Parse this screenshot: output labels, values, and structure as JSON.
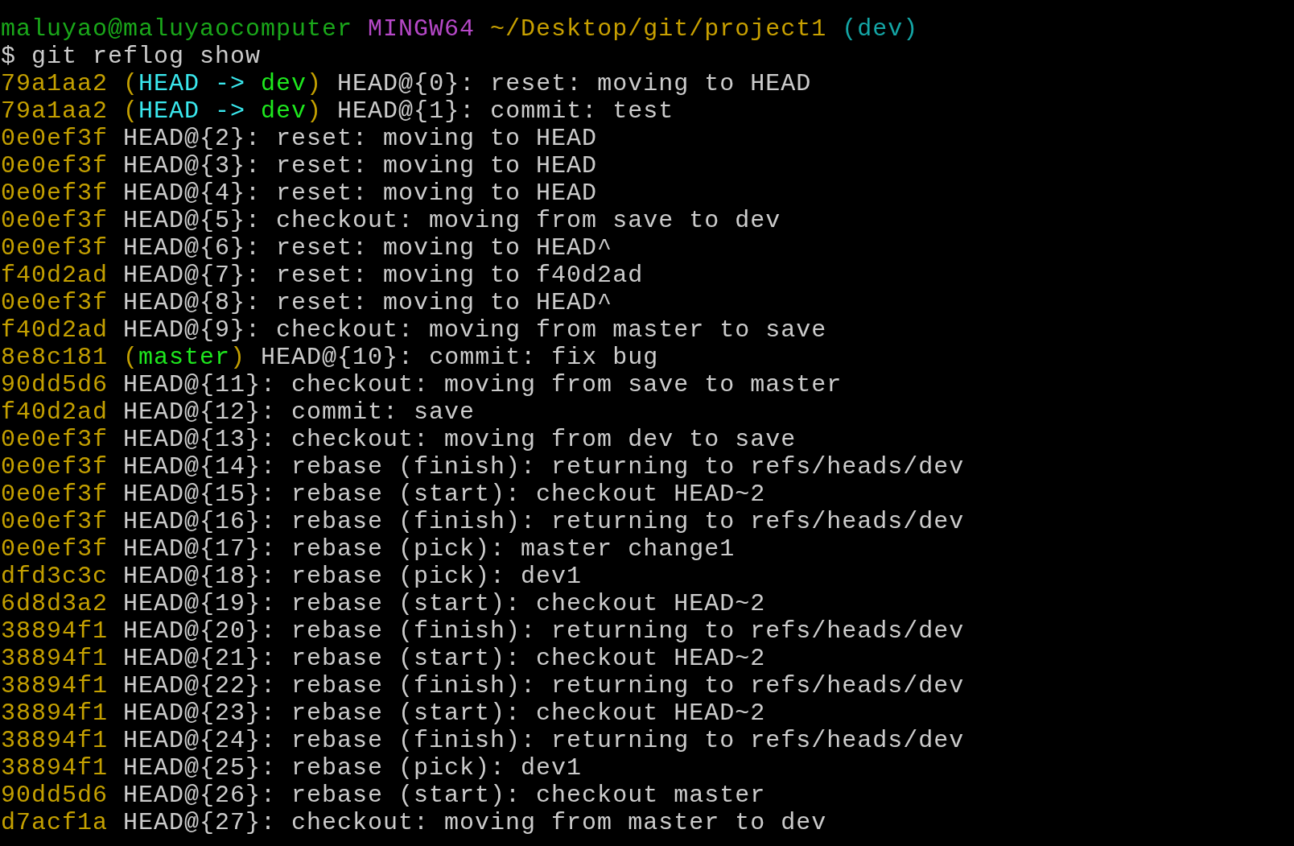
{
  "terminal": {
    "prompt": {
      "user_host": "maluyao@maluyaocomputer",
      "system": "MINGW64",
      "path": "~/Desktop/git/project1",
      "branch": "(dev)"
    },
    "command": {
      "symbol": "$",
      "text": "git reflog show"
    },
    "entries": [
      {
        "hash": "79a1aa2",
        "decoration": [
          {
            "text": "(",
            "kind": "paren"
          },
          {
            "text": "HEAD -> ",
            "kind": "head"
          },
          {
            "text": "dev",
            "kind": "branch"
          },
          {
            "text": ")",
            "kind": "paren"
          }
        ],
        "text": "HEAD@{0}: reset: moving to HEAD"
      },
      {
        "hash": "79a1aa2",
        "decoration": [
          {
            "text": "(",
            "kind": "paren"
          },
          {
            "text": "HEAD -> ",
            "kind": "head"
          },
          {
            "text": "dev",
            "kind": "branch"
          },
          {
            "text": ")",
            "kind": "paren"
          }
        ],
        "text": "HEAD@{1}: commit: test"
      },
      {
        "hash": "0e0ef3f",
        "text": "HEAD@{2}: reset: moving to HEAD"
      },
      {
        "hash": "0e0ef3f",
        "text": "HEAD@{3}: reset: moving to HEAD"
      },
      {
        "hash": "0e0ef3f",
        "text": "HEAD@{4}: reset: moving to HEAD"
      },
      {
        "hash": "0e0ef3f",
        "text": "HEAD@{5}: checkout: moving from save to dev"
      },
      {
        "hash": "0e0ef3f",
        "text": "HEAD@{6}: reset: moving to HEAD^"
      },
      {
        "hash": "f40d2ad",
        "text": "HEAD@{7}: reset: moving to f40d2ad"
      },
      {
        "hash": "0e0ef3f",
        "text": "HEAD@{8}: reset: moving to HEAD^"
      },
      {
        "hash": "f40d2ad",
        "text": "HEAD@{9}: checkout: moving from master to save"
      },
      {
        "hash": "8e8c181",
        "decoration": [
          {
            "text": "(",
            "kind": "paren"
          },
          {
            "text": "master",
            "kind": "branch"
          },
          {
            "text": ")",
            "kind": "paren"
          }
        ],
        "text": "HEAD@{10}: commit: fix bug"
      },
      {
        "hash": "90dd5d6",
        "text": "HEAD@{11}: checkout: moving from save to master"
      },
      {
        "hash": "f40d2ad",
        "text": "HEAD@{12}: commit: save"
      },
      {
        "hash": "0e0ef3f",
        "text": "HEAD@{13}: checkout: moving from dev to save"
      },
      {
        "hash": "0e0ef3f",
        "text": "HEAD@{14}: rebase (finish): returning to refs/heads/dev"
      },
      {
        "hash": "0e0ef3f",
        "text": "HEAD@{15}: rebase (start): checkout HEAD~2"
      },
      {
        "hash": "0e0ef3f",
        "text": "HEAD@{16}: rebase (finish): returning to refs/heads/dev"
      },
      {
        "hash": "0e0ef3f",
        "text": "HEAD@{17}: rebase (pick): master change1"
      },
      {
        "hash": "dfd3c3c",
        "text": "HEAD@{18}: rebase (pick): dev1"
      },
      {
        "hash": "6d8d3a2",
        "text": "HEAD@{19}: rebase (start): checkout HEAD~2"
      },
      {
        "hash": "38894f1",
        "text": "HEAD@{20}: rebase (finish): returning to refs/heads/dev"
      },
      {
        "hash": "38894f1",
        "text": "HEAD@{21}: rebase (start): checkout HEAD~2"
      },
      {
        "hash": "38894f1",
        "text": "HEAD@{22}: rebase (finish): returning to refs/heads/dev"
      },
      {
        "hash": "38894f1",
        "text": "HEAD@{23}: rebase (start): checkout HEAD~2"
      },
      {
        "hash": "38894f1",
        "text": "HEAD@{24}: rebase (finish): returning to refs/heads/dev"
      },
      {
        "hash": "38894f1",
        "text": "HEAD@{25}: rebase (pick): dev1"
      },
      {
        "hash": "90dd5d6",
        "text": "HEAD@{26}: rebase (start): checkout master"
      },
      {
        "hash": "d7acf1a",
        "text": "HEAD@{27}: checkout: moving from master to dev"
      }
    ]
  }
}
